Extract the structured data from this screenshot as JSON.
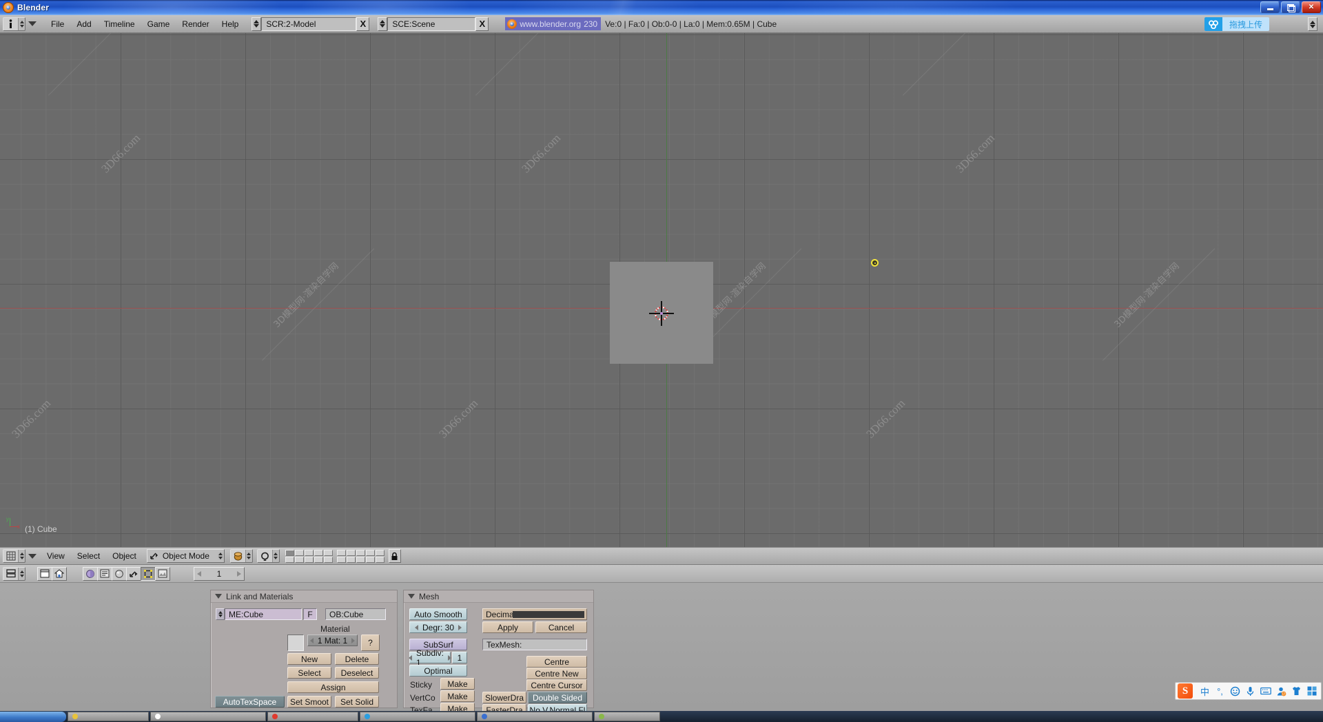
{
  "window": {
    "title": "Blender",
    "controls": {
      "minimize": "minimize-button",
      "restore": "restore-button",
      "close": "close-button"
    }
  },
  "topbar": {
    "window_type_icon": "info-icon",
    "menus": [
      "File",
      "Add",
      "Timeline",
      "Game",
      "Render",
      "Help"
    ],
    "screen_selector": {
      "value": "SCR:2-Model",
      "delete_label": "X"
    },
    "scene_selector": {
      "value": "SCE:Scene",
      "delete_label": "X"
    },
    "version_badge": {
      "site": "www.blender.org",
      "version": "230"
    },
    "status": "Ve:0 | Fa:0 | Ob:0-0 | La:0 | Mem:0.65M | Cube",
    "upload_widget": {
      "label": "拖拽上传",
      "icon": "cloud-upload-icon"
    }
  },
  "viewport": {
    "object_label": "(1) Cube",
    "axis_gizmo": {
      "y": "y",
      "x": "x"
    },
    "objects": {
      "cube": "Cube",
      "lamp": "Lamp"
    },
    "cursor": "3d-cursor",
    "watermarks": [
      "3D66.com",
      "3D66.com",
      "3D66.com",
      "3D66.com",
      "3D66.com",
      "3D66.com"
    ],
    "watermarks_cn": [
      "3D模型网·渲染自学网",
      "3D模型网·渲染自学网",
      "3D模型网·渲染自学网"
    ],
    "colors": {
      "background": "#6b6b6b",
      "grid": "#787878",
      "x_axis": "#9a4f4f",
      "y_axis": "#4c7a45",
      "cube": "#8a8a8a",
      "lamp": "#f2e53c"
    }
  },
  "viewport_header": {
    "window_type_icon": "3d-view-icon",
    "menus": [
      "View",
      "Select",
      "Object"
    ],
    "mode": {
      "label": "Object Mode",
      "icon": "object-mode-icon"
    },
    "draw_type_icon": "shading-solid-icon",
    "pivot_icon": "rotate-manipulator-icon",
    "layers": {
      "top": [
        true,
        false,
        false,
        false,
        false,
        false,
        false,
        false,
        false,
        false
      ],
      "bottom": [
        false,
        false,
        false,
        false,
        false,
        false,
        false,
        false,
        false,
        false
      ]
    },
    "lock_icon": "lock-icon"
  },
  "buttons_header": {
    "window_type_icon": "buttons-window-icon",
    "view_buttons": [
      "panel-view-icon",
      "home-icon"
    ],
    "context_buttons": [
      {
        "name": "shading-icon",
        "selected": false
      },
      {
        "name": "scene-icon",
        "selected": false
      },
      {
        "name": "object-icon",
        "selected": false
      },
      {
        "name": "constraints-icon",
        "selected": false
      },
      {
        "name": "editing-icon",
        "selected": true
      },
      {
        "name": "scripts-icon",
        "selected": false
      }
    ],
    "frame": {
      "value": "1"
    }
  },
  "panels": [
    {
      "id": "link-and-materials",
      "title": "Link and Materials",
      "mesh_field": {
        "value": "ME:Cube",
        "fake_user": "F"
      },
      "object_field": {
        "value": "OB:Cube"
      },
      "material_label": "Material",
      "material_index": "1 Mat: 1",
      "help_label": "?",
      "buttons": [
        "New",
        "Delete",
        "Select",
        "Deselect",
        "Assign"
      ],
      "auto_tex_space": "AutoTexSpace",
      "set_smooth": "Set Smoot",
      "set_solid": "Set Solid"
    },
    {
      "id": "mesh",
      "title": "Mesh",
      "auto_smooth": "Auto Smooth",
      "degr": "Degr: 30",
      "subsurf": "SubSurf",
      "subdiv": "Subdiv: 1",
      "subdiv_render": "1",
      "optimal": "Optimal",
      "rows": [
        {
          "label": "Sticky",
          "button": "Make"
        },
        {
          "label": "VertCo",
          "button": "Make"
        },
        {
          "label": "TexFa",
          "button": "Make"
        }
      ],
      "decimator": "Decimator: 1",
      "apply": "Apply",
      "cancel": "Cancel",
      "texmesh": "TexMesh:",
      "centre": "Centre",
      "centre_new": "Centre New",
      "centre_cursor": "Centre Cursor",
      "slower_draw": "SlowerDra",
      "faster_draw": "FasterDra",
      "double_sided": "Double Sided",
      "no_vnormal_flip": "No V.Normal Fl"
    }
  ],
  "ime": {
    "logo": "S",
    "items": [
      "中",
      "°,",
      "☺",
      "🎤",
      "⌨",
      "👤",
      "👕",
      "▦"
    ]
  },
  "taskbar": {
    "start": "start-button",
    "items": [
      {
        "color": "#e8c33a",
        "label": ""
      },
      {
        "color": "#ffffff",
        "label": ""
      },
      {
        "color": "#e03a2f",
        "label": ""
      },
      {
        "color": "#2a9ee0",
        "label": ""
      },
      {
        "color": "#3a6fd0",
        "label": ""
      },
      {
        "color": "#8ab84a",
        "label": ""
      }
    ]
  }
}
